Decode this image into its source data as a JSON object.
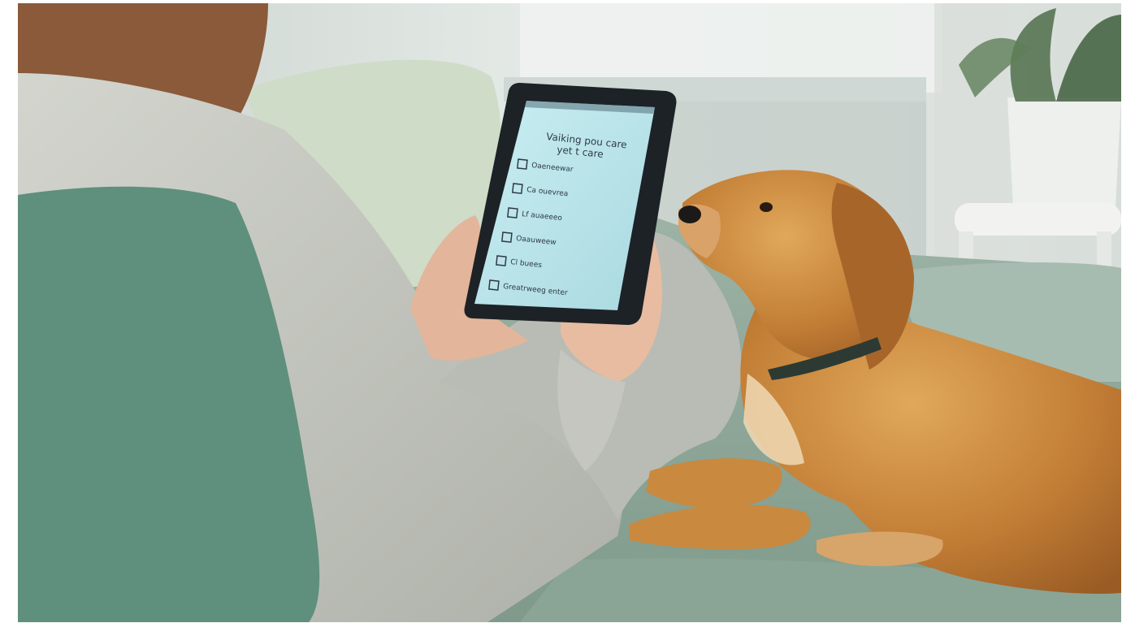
{
  "photo": {
    "subject": "person-with-tablet-and-dog",
    "colors": {
      "sofa": "#8fa99b",
      "cushion_dark": "#5f8f7d",
      "cushion_light": "#cfdcc8",
      "sweater": "#c9cbc4",
      "dog_fur": "#c98a3c",
      "tablet_screen": "#bde4ea",
      "background_room": "#dfe5e2"
    }
  },
  "tablet": {
    "screen": {
      "title_line1": "Vaiking pou care",
      "title_line2": "yet t care",
      "checklist": [
        {
          "label": "Oaeneewar",
          "checked": false
        },
        {
          "label": "Ca ouevrea",
          "checked": false
        },
        {
          "label": "Lf auaeeeo",
          "checked": false
        },
        {
          "label": "Oaauweew",
          "checked": false
        },
        {
          "label": "Cl buees",
          "checked": false
        },
        {
          "label": "Greatrweeg enter",
          "checked": false
        }
      ]
    }
  }
}
